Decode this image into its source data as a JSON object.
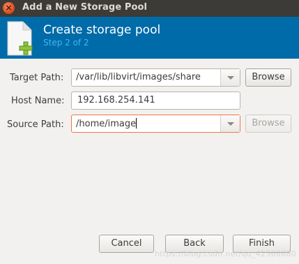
{
  "window": {
    "title": "Add a New Storage Pool",
    "close_symbol": "×"
  },
  "header": {
    "title": "Create storage pool",
    "subtitle": "Step 2 of 2",
    "icon": "new-document-icon"
  },
  "form": {
    "target_path": {
      "label": "Target Path:",
      "value": "/var/lib/libvirt/images/share",
      "browse_label": "Browse",
      "browse_enabled": true
    },
    "host_name": {
      "label": "Host Name:",
      "value": "192.168.254.141"
    },
    "source_path": {
      "label": "Source Path:",
      "value": "/home/image",
      "browse_label": "Browse",
      "browse_enabled": false
    }
  },
  "buttons": {
    "cancel": "Cancel",
    "back": "Back",
    "finish": "Finish"
  },
  "watermark": "https://blog.csdn.net/qq_42566680",
  "colors": {
    "titlebar": "#3c3b37",
    "header": "#006ba9",
    "subtitle": "#43b4ef",
    "focus_border": "#f07746",
    "close_button": "#e0501f"
  }
}
